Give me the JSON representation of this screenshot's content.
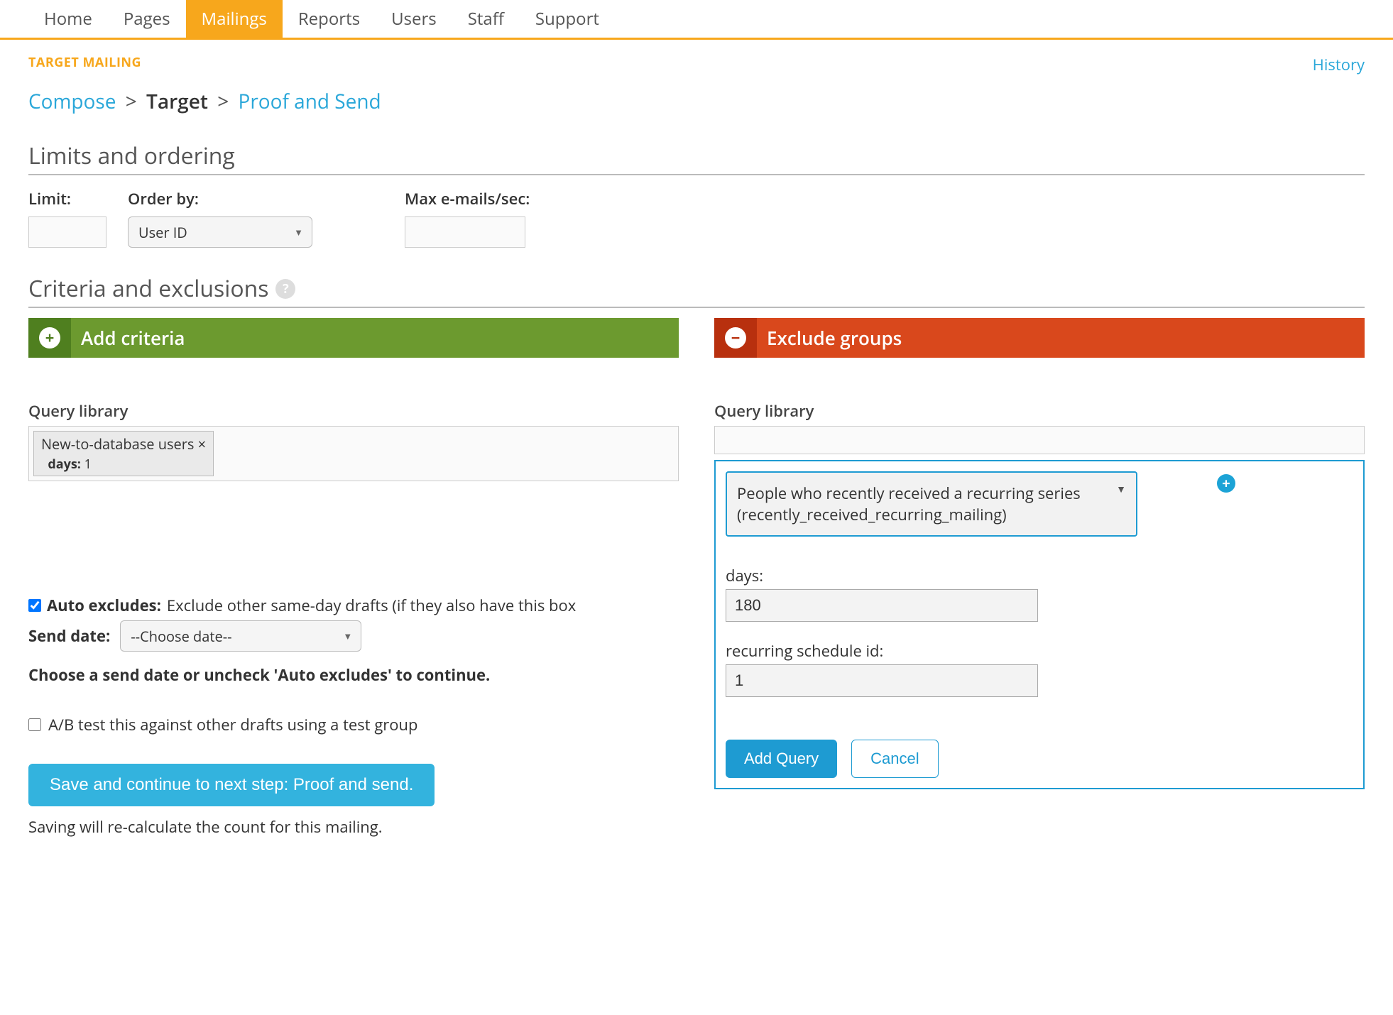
{
  "nav": {
    "items": [
      {
        "label": "Home",
        "active": false
      },
      {
        "label": "Pages",
        "active": false
      },
      {
        "label": "Mailings",
        "active": true
      },
      {
        "label": "Reports",
        "active": false
      },
      {
        "label": "Users",
        "active": false
      },
      {
        "label": "Staff",
        "active": false
      },
      {
        "label": "Support",
        "active": false
      }
    ]
  },
  "page_header": {
    "target_mailing_label": "TARGET MAILING",
    "history_link": "History"
  },
  "breadcrumb": {
    "compose": "Compose",
    "sep": ">",
    "target": "Target",
    "proof_and_send": "Proof and Send"
  },
  "limits": {
    "title": "Limits and ordering",
    "limit_label": "Limit:",
    "order_by_label": "Order by:",
    "order_by_value": "User ID",
    "max_emails_label": "Max e-mails/sec:",
    "limit_value": "",
    "max_emails_value": ""
  },
  "criteria": {
    "title": "Criteria and exclusions",
    "add_criteria_banner": "Add criteria",
    "exclude_groups_banner": "Exclude groups",
    "query_library_label": "Query library",
    "left_tag_name": "New-to-database users",
    "left_tag_param_key": "days:",
    "left_tag_param_val": "1"
  },
  "auto_excludes": {
    "checkbox_label": "Auto excludes:",
    "description": "Exclude other same-day drafts (if they also have this box",
    "send_date_label": "Send date:",
    "send_date_value": "--Choose date--",
    "warning": "Choose a send date or uncheck 'Auto excludes' to continue."
  },
  "ab_test": {
    "label": "A/B test this against other drafts using a test group"
  },
  "save": {
    "button": "Save and continue to next step: Proof and send.",
    "note": "Saving will re-calculate the count for this mailing."
  },
  "exclude_panel": {
    "select_value": "People who recently received a recurring series (recently_received_recurring_mailing)",
    "days_label": "days:",
    "days_value": "180",
    "schedule_label": "recurring schedule id:",
    "schedule_value": "1",
    "add_query_btn": "Add Query",
    "cancel_btn": "Cancel"
  }
}
